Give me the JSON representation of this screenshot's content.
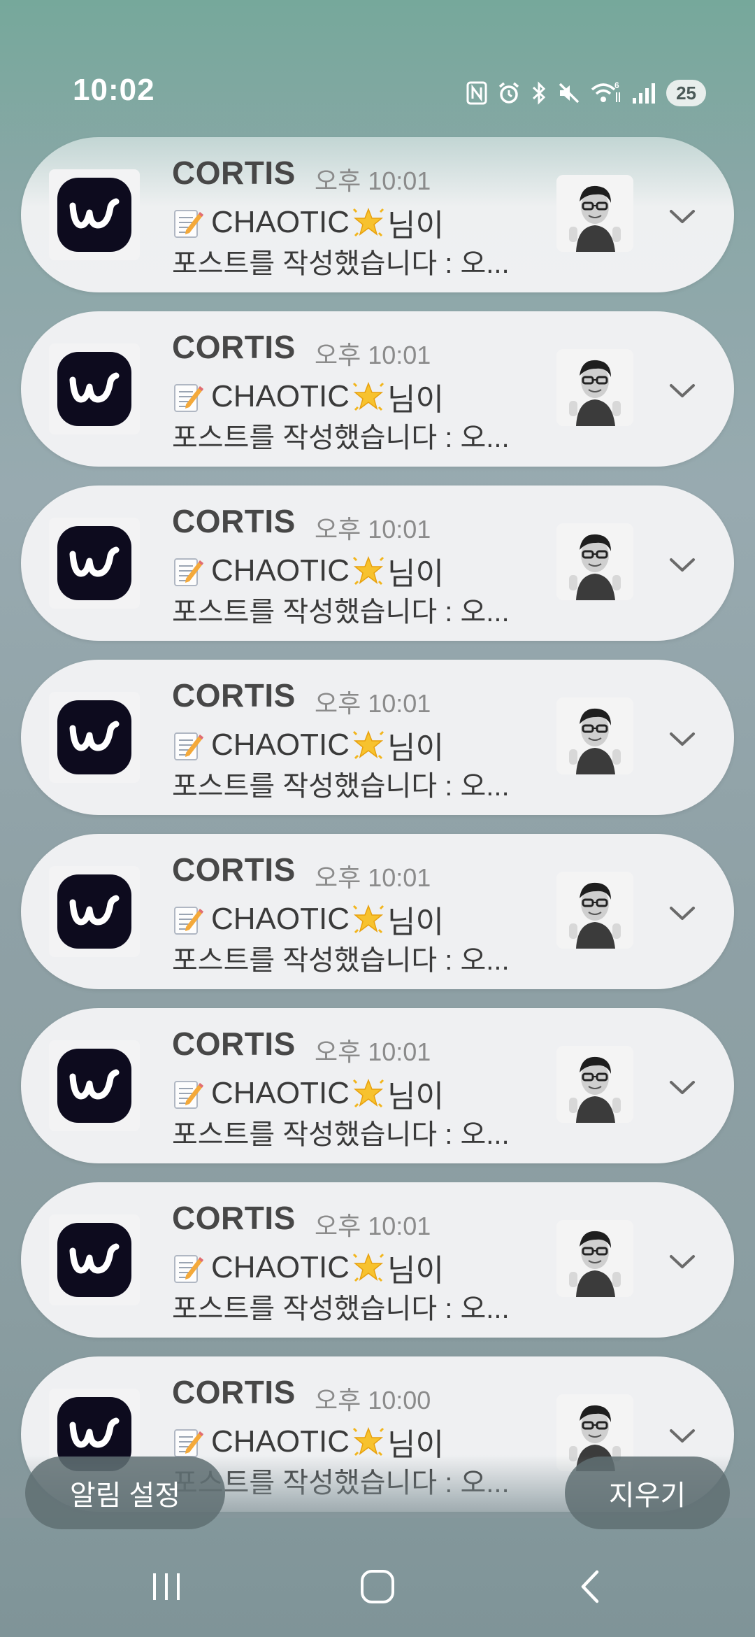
{
  "status_bar": {
    "time": "10:02",
    "battery": "25",
    "icons": [
      "nfc-icon",
      "alarm-icon",
      "bluetooth-icon",
      "mute-icon",
      "wifi-icon",
      "signal-icon"
    ]
  },
  "notifications": [
    {
      "app_name": "CORTIS",
      "time": "오후 10:01",
      "title_prefix": "CHAOTIC",
      "title_suffix": "님이",
      "body": "포스트를 작성했습니다 : 오..."
    },
    {
      "app_name": "CORTIS",
      "time": "오후 10:01",
      "title_prefix": "CHAOTIC",
      "title_suffix": "님이",
      "body": "포스트를 작성했습니다 : 오..."
    },
    {
      "app_name": "CORTIS",
      "time": "오후 10:01",
      "title_prefix": "CHAOTIC",
      "title_suffix": "님이",
      "body": "포스트를 작성했습니다 : 오..."
    },
    {
      "app_name": "CORTIS",
      "time": "오후 10:01",
      "title_prefix": "CHAOTIC",
      "title_suffix": "님이",
      "body": "포스트를 작성했습니다 : 오..."
    },
    {
      "app_name": "CORTIS",
      "time": "오후 10:01",
      "title_prefix": "CHAOTIC",
      "title_suffix": "님이",
      "body": "포스트를 작성했습니다 : 오..."
    },
    {
      "app_name": "CORTIS",
      "time": "오후 10:01",
      "title_prefix": "CHAOTIC",
      "title_suffix": "님이",
      "body": "포스트를 작성했습니다 : 오..."
    },
    {
      "app_name": "CORTIS",
      "time": "오후 10:01",
      "title_prefix": "CHAOTIC",
      "title_suffix": "님이",
      "body": "포스트를 작성했습니다 : 오..."
    },
    {
      "app_name": "CORTIS",
      "time": "오후 10:00",
      "title_prefix": "CHAOTIC",
      "title_suffix": "님이",
      "body": "포스트를 작성했습니다 : 오..."
    }
  ],
  "actions": {
    "settings_label": "알림 설정",
    "clear_label": "지우기"
  },
  "colors": {
    "app_icon_bg": "#0d0b1e",
    "card_bg": "#eff0f2",
    "pill_bg": "#5f6e72"
  }
}
